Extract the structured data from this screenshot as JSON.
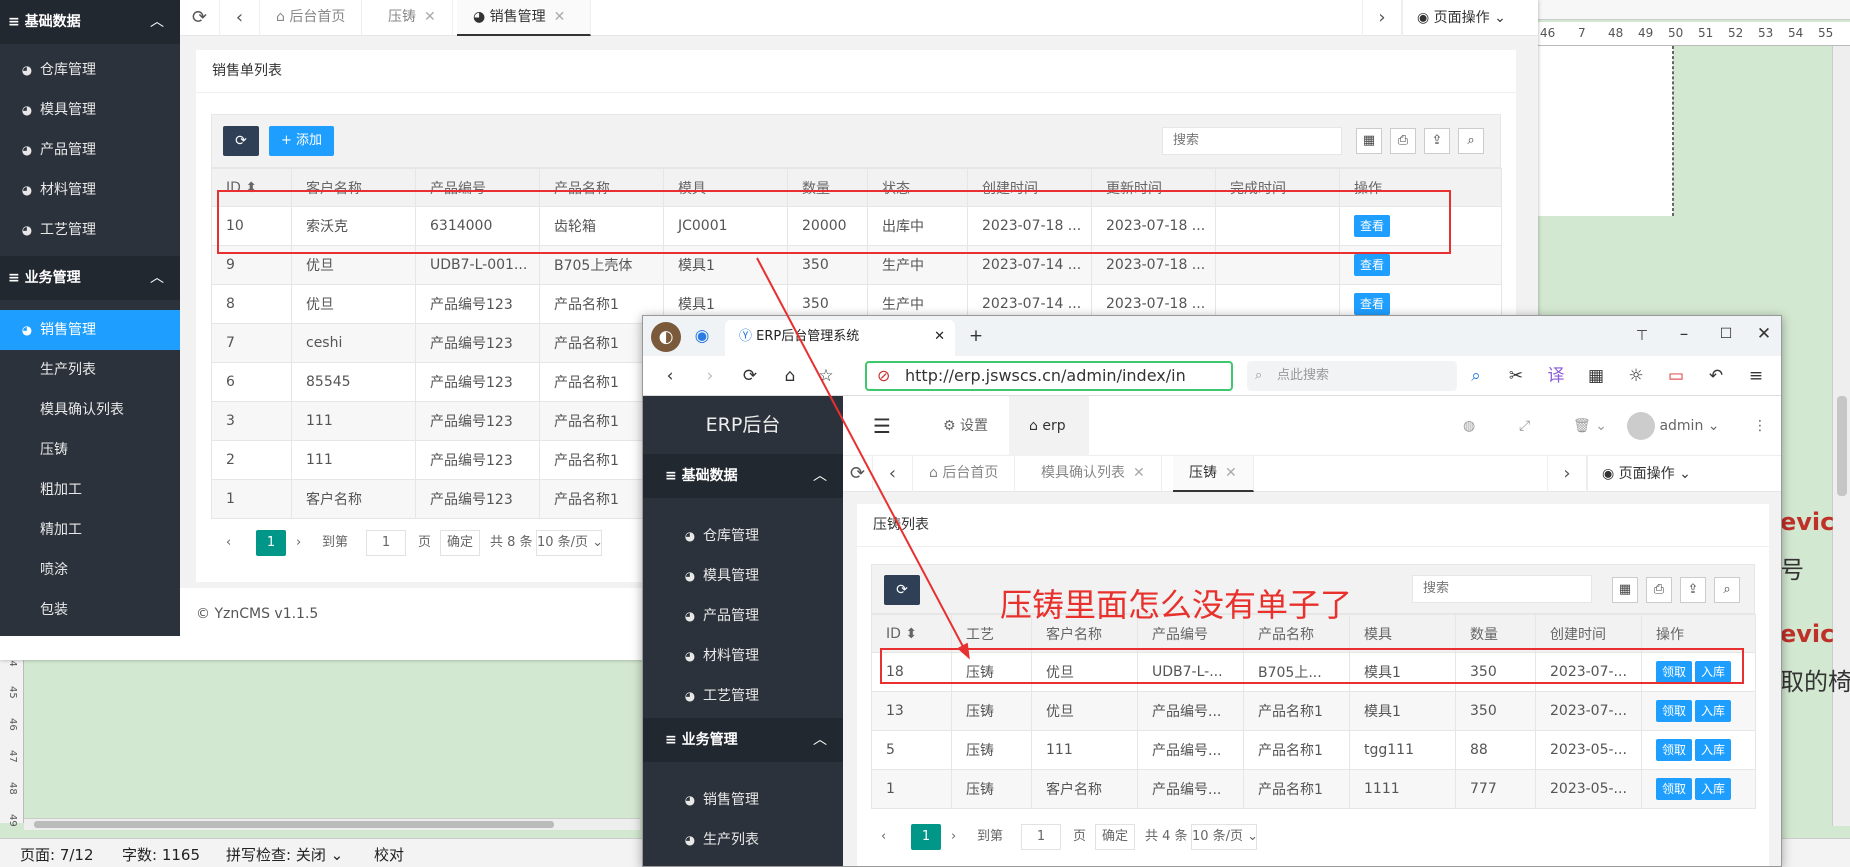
{
  "word": {
    "ruler_numbers": [
      "46",
      "7",
      "48",
      "49",
      "50",
      "51",
      "52",
      "53",
      "54",
      "55"
    ],
    "right_text": [
      {
        "text": "evic",
        "color": "#c0302a"
      },
      {
        "text": "号",
        "color": "#222"
      },
      {
        "text": "evic",
        "color": "#c0302a"
      },
      {
        "text": "取的椅",
        "color": "#222"
      }
    ],
    "left_ruler": [
      "44",
      "45",
      "46",
      "47",
      "48",
      "49"
    ],
    "status": {
      "page": "页面: 7/12",
      "words": "字数: 1165",
      "spell": "拼写检查: 关闭 ⌄",
      "proof": "校对"
    }
  },
  "win1": {
    "sidebar": {
      "groups": [
        {
          "label": "基础数据",
          "chev": "︿"
        },
        {
          "label": "业务管理",
          "chev": "︿"
        }
      ],
      "base_items": [
        "仓库管理",
        "模具管理",
        "产品管理",
        "材料管理",
        "工艺管理"
      ],
      "biz_items": [
        "销售管理",
        "生产列表",
        "模具确认列表",
        "压铸",
        "粗加工",
        "精加工",
        "喷涂",
        "包装"
      ]
    },
    "tabs": [
      {
        "label": "后台首页",
        "close": ""
      },
      {
        "label": "压铸",
        "close": "✕"
      },
      {
        "label": "销售管理",
        "close": "✕"
      }
    ],
    "page_op": "页面操作 ⌄",
    "card_title": "销售单列表",
    "add_label": "+ 添加",
    "search_placeholder": "搜索",
    "columns": [
      "ID ⬍",
      "客户名称",
      "产品编号",
      "产品名称",
      "模具",
      "数量",
      "状态",
      "创建时间",
      "更新时间",
      "完成时间",
      "操作"
    ],
    "rows": [
      [
        "10",
        "索沃克",
        "6314000",
        "齿轮箱",
        "JC0001",
        "20000",
        "出库中",
        "2023-07-18 ...",
        "2023-07-18 ...",
        "",
        "查看"
      ],
      [
        "9",
        "优旦",
        "UDB7-L-001...",
        "B705上壳体",
        "模具1",
        "350",
        "生产中",
        "2023-07-14 ...",
        "2023-07-18 ...",
        "",
        "查看"
      ],
      [
        "8",
        "优旦",
        "产品编号123",
        "产品名称1",
        "模具1",
        "350",
        "生产中",
        "2023-07-14 ...",
        "2023-07-18 ...",
        "",
        "查看"
      ],
      [
        "7",
        "ceshi",
        "产品编号123",
        "产品名称1",
        "",
        "",
        "",
        "",
        "",
        "",
        ""
      ],
      [
        "6",
        "85545",
        "产品编号123",
        "产品名称1",
        "",
        "",
        "",
        "",
        "",
        "",
        ""
      ],
      [
        "3",
        "111",
        "产品编号123",
        "产品名称1",
        "",
        "",
        "",
        "",
        "",
        "",
        ""
      ],
      [
        "2",
        "111",
        "产品编号123",
        "产品名称1",
        "",
        "",
        "",
        "",
        "",
        "",
        ""
      ],
      [
        "1",
        "客户名称",
        "产品编号123",
        "产品名称1",
        "",
        "",
        "",
        "",
        "",
        "",
        ""
      ]
    ],
    "pager": {
      "prev": "‹",
      "page": "1",
      "next": "›",
      "goto": "到第",
      "goto_val": "1",
      "page_unit": "页",
      "confirm": "确定",
      "total": "共 8 条",
      "size": "10 条/页 ⌄"
    },
    "footer": "© YznCMS v1.1.5"
  },
  "win2": {
    "browser_tab": "ERP后台管理系统",
    "url": "http://erp.jswscs.cn/admin/index/in",
    "browser_search": "点此搜索",
    "brand": "ERP后台",
    "header": {
      "settings": "设置",
      "erp": "erp",
      "user": "admin"
    },
    "sidebar": {
      "groups": [
        {
          "label": "基础数据",
          "chev": "︿"
        },
        {
          "label": "业务管理",
          "chev": "︿"
        }
      ],
      "base_items": [
        "仓库管理",
        "模具管理",
        "产品管理",
        "材料管理",
        "工艺管理"
      ],
      "biz_items": [
        "销售管理",
        "生产列表"
      ]
    },
    "tabs": [
      {
        "label": "后台首页",
        "close": ""
      },
      {
        "label": "模具确认列表",
        "close": "✕"
      },
      {
        "label": "压铸",
        "close": "✕"
      }
    ],
    "page_op": "页面操作 ⌄",
    "card_title": "压铸列表",
    "search_placeholder": "搜索",
    "columns": [
      "ID ⬍",
      "工艺",
      "客户名称",
      "产品编号",
      "产品名称",
      "模具",
      "数量",
      "创建时间",
      "操作"
    ],
    "rows": [
      [
        "18",
        "压铸",
        "优旦",
        "UDB7-L-...",
        "B705上...",
        "模具1",
        "350",
        "2023-07-...",
        "领取|入库"
      ],
      [
        "13",
        "压铸",
        "优旦",
        "产品编号...",
        "产品名称1",
        "模具1",
        "350",
        "2023-07-...",
        "领取|入库"
      ],
      [
        "5",
        "压铸",
        "111",
        "产品编号...",
        "产品名称1",
        "tgg111",
        "88",
        "2023-05-...",
        "领取|入库"
      ],
      [
        "1",
        "压铸",
        "客户名称",
        "产品编号...",
        "产品名称1",
        "1111",
        "777",
        "2023-05-...",
        "领取|入库"
      ]
    ],
    "pager": {
      "prev": "‹",
      "page": "1",
      "next": "›",
      "goto": "到第",
      "goto_val": "1",
      "page_unit": "页",
      "confirm": "确定",
      "total": "共 4 条",
      "size": "10 条/页 ⌄"
    }
  },
  "annotation": "压铸里面怎么没有单子了",
  "colors": {
    "accent": "#1e9fff",
    "sidebar": "#2c323b",
    "annotation": "#e83030",
    "pager_active": "#009688"
  }
}
